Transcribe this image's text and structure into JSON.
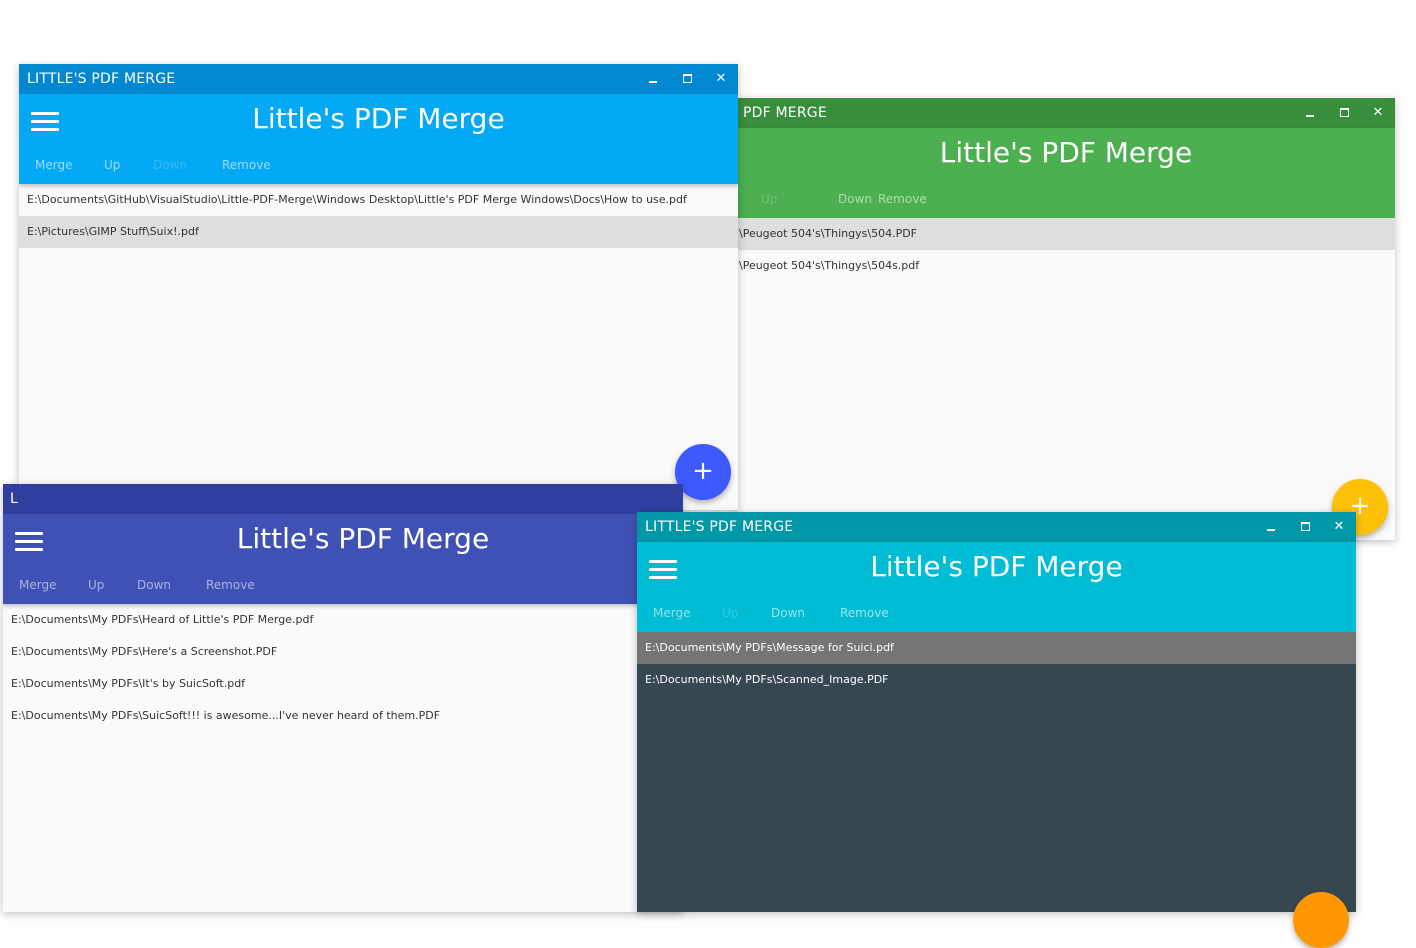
{
  "windows": {
    "green": {
      "title": "PDF MERGE",
      "app_title": "Little's PDF Merge",
      "actions": {
        "up": "Up",
        "down": "Down",
        "remove": "Remove"
      },
      "files": [
        "\\Peugeot 504's\\Thingys\\504.PDF",
        "\\Peugeot 504's\\Thingys\\504s.pdf"
      ],
      "fab": "+",
      "colors": {
        "titlebar": "#388E3C",
        "appbar": "#4CAF50",
        "fab": "#FFC107"
      }
    },
    "blue": {
      "title": "LITTLE'S PDF MERGE",
      "app_title": "Little's PDF Merge",
      "actions": {
        "merge": "Merge",
        "up": "Up",
        "down": "Down",
        "remove": "Remove"
      },
      "files": [
        "E:\\Documents\\GitHub\\VisualStudio\\Little-PDF-Merge\\Windows Desktop\\Little's PDF Merge Windows\\Docs\\How to use.pdf",
        "E:\\Pictures\\GIMP Stuff\\Suix!.pdf"
      ],
      "fab": "+",
      "colors": {
        "titlebar": "#0288D1",
        "appbar": "#03A9F4",
        "fab": "#3D5AFE"
      }
    },
    "indigo": {
      "title_fragment": "L",
      "app_title": "Little's PDF Merge",
      "actions": {
        "merge": "Merge",
        "up": "Up",
        "down": "Down",
        "remove": "Remove"
      },
      "files": [
        "E:\\Documents\\My PDFs\\Heard of Little's PDF Merge.pdf",
        "E:\\Documents\\My PDFs\\Here's a Screenshot.PDF",
        "E:\\Documents\\My PDFs\\It's by SuicSoft.pdf",
        "E:\\Documents\\My PDFs\\SuicSoft!!! is awesome...I've never heard of them.PDF"
      ],
      "colors": {
        "titlebar": "#303F9F",
        "appbar": "#3F51B5"
      }
    },
    "cyan": {
      "title": "LITTLE'S PDF MERGE",
      "app_title": "Little's PDF Merge",
      "actions": {
        "merge": "Merge",
        "up": "Up",
        "down": "Down",
        "remove": "Remove"
      },
      "files": [
        "E:\\Documents\\My PDFs\\Message for Suici.pdf",
        "E:\\Documents\\My PDFs\\Scanned_Image.PDF"
      ],
      "colors": {
        "titlebar": "#0097A7",
        "appbar": "#00BCD4",
        "body": "#37474F",
        "fab": "#FF9800"
      }
    }
  }
}
